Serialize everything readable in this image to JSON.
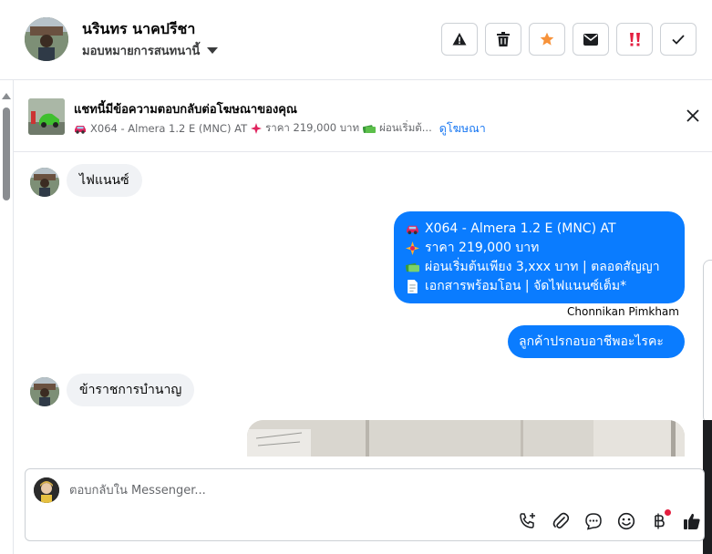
{
  "header": {
    "contact_name": "นรินทร นาคปรีชา",
    "assign_label": "มอบหมายการสนทนานี้",
    "actions": [
      {
        "name": "report-spam-button",
        "icon": "warning-icon",
        "color": "#1c1e21"
      },
      {
        "name": "delete-button",
        "icon": "trash-icon",
        "color": "#1c1e21"
      },
      {
        "name": "star-button",
        "icon": "star-icon",
        "color": "#f7923a"
      },
      {
        "name": "mark-unread-button",
        "icon": "envelope-icon",
        "color": "#1c1e21"
      },
      {
        "name": "follow-up-button",
        "icon": "follow-up-icon",
        "color": "#e41e3f"
      },
      {
        "name": "mark-done-button",
        "icon": "check-icon",
        "color": "#1c1e21"
      }
    ]
  },
  "banner": {
    "title": "แชทนี้มีข้อความตอบกลับต่อโฆษณาของคุณ",
    "subtitle": "X064 - Almera 1.2 E (MNC) AT",
    "subtitle_price": "ราคา 219,000 บาท",
    "subtitle_tail": "ผ่อนเริ่มต้...",
    "link": "ดูโฆษณา"
  },
  "messages": {
    "in_1": "ไฟแนนซ์",
    "out_multi": [
      {
        "emoji": "car-icon",
        "text": "X064 - Almera 1.2 E (MNC) AT"
      },
      {
        "emoji": "sparkle-icon",
        "text": "ราคา 219,000 บาท"
      },
      {
        "emoji": "money-icon",
        "text": "ผ่อนเริ่มต้นเพียง 3,xxx บาท | ตลอดสัญญา"
      },
      {
        "emoji": "document-icon",
        "text": "เอกสารพร้อมโอน | จัดไฟแนนซ์เต็ม*"
      }
    ],
    "sender": "Chonnikan Pimkham",
    "out_single": "ลูกค้าปรกอบอาชีพอะไรคะ",
    "in_2": "ข้าราชการบำนาญ"
  },
  "composer": {
    "placeholder": "ตอบกลับใน Messenger..."
  },
  "colors": {
    "accent": "#0a7cff",
    "link": "#1877f2",
    "incoming_bubble": "#f0f2f5"
  }
}
